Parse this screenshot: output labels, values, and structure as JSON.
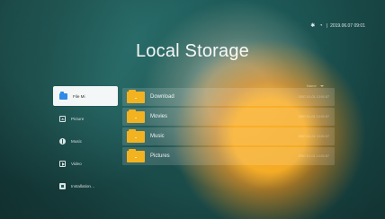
{
  "status": {
    "icons": [
      "bluetooth-icon",
      "wifi-icon"
    ],
    "datetime": "2019.06.07 09:01"
  },
  "header": {
    "title": "Local Storage"
  },
  "sort": {
    "label": "Name"
  },
  "sidebar": {
    "items": [
      {
        "label": "File Mi",
        "icon": "folder-icon",
        "active": true
      },
      {
        "label": "Picture",
        "icon": "picture-icon",
        "active": false
      },
      {
        "label": "Music",
        "icon": "music-icon",
        "active": false
      },
      {
        "label": "Video",
        "icon": "video-icon",
        "active": false
      },
      {
        "label": "Installation…",
        "icon": "install-icon",
        "active": false
      }
    ]
  },
  "files": [
    {
      "name": "Download",
      "date": "2007-01-01 13:01:57"
    },
    {
      "name": "Movies",
      "date": "2007-01-01 13:01:57"
    },
    {
      "name": "Music",
      "date": "2007-01-01 13:01:57"
    },
    {
      "name": "Pictures",
      "date": "2007-01-01 13:01:57"
    }
  ],
  "colors": {
    "folder_yellow": "#f3b21f",
    "folder_blue": "#2f8be6"
  }
}
